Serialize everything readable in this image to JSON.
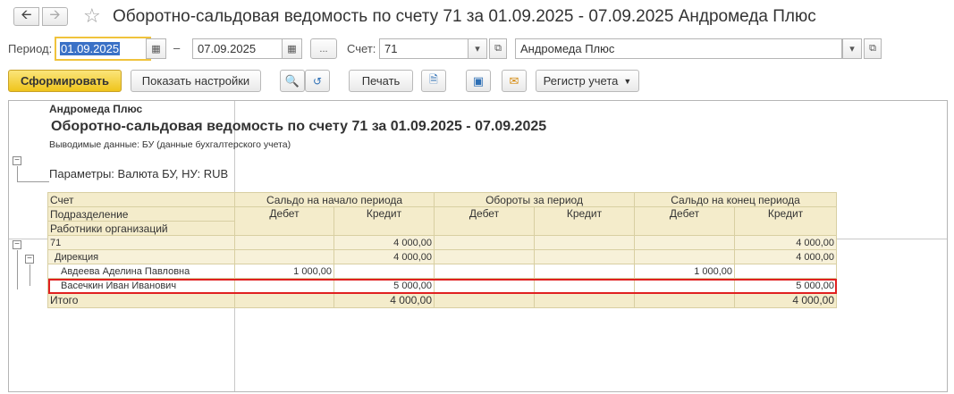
{
  "window": {
    "title": "Оборотно-сальдовая ведомость по счету 71 за 01.09.2025 - 07.09.2025 Андромеда Плюс",
    "back_icon": "arrow-left-icon",
    "forward_icon": "arrow-right-icon",
    "favorite_icon": "star-icon"
  },
  "params": {
    "period_label": "Период:",
    "date_from": "01.09.2025",
    "dash": "–",
    "date_to": "07.09.2025",
    "dots": "...",
    "account_label": "Счет:",
    "account": "71",
    "organization": "Андромеда Плюс"
  },
  "toolbar": {
    "generate": "Сформировать",
    "show_settings": "Показать настройки",
    "print": "Печать",
    "registry": "Регистр учета"
  },
  "report": {
    "org": "Андромеда Плюс",
    "title": "Оборотно-сальдовая ведомость по счету 71 за 01.09.2025 - 07.09.2025",
    "output": "Выводимые данные:  БУ (данные бухгалтерского учета)",
    "parameters": "Параметры:    Валюта БУ, НУ: RUB"
  },
  "table": {
    "headers": {
      "account": "Счет",
      "department": "Подразделение",
      "employees": "Работники организаций",
      "opening": "Сальдо на начало периода",
      "turnover": "Обороты за период",
      "closing": "Сальдо на конец периода",
      "debit": "Дебет",
      "credit": "Кредит"
    },
    "rows": [
      {
        "name": "71",
        "od": "",
        "oc": "4 000,00",
        "td": "",
        "tc": "",
        "cd": "",
        "cc": "4 000,00"
      },
      {
        "name": "Дирекция",
        "od": "",
        "oc": "4 000,00",
        "td": "",
        "tc": "",
        "cd": "",
        "cc": "4 000,00"
      },
      {
        "name": "Авдеева Аделина Павловна",
        "od": "1 000,00",
        "oc": "",
        "td": "",
        "tc": "",
        "cd": "1 000,00",
        "cc": ""
      },
      {
        "name": "Васечкин Иван Иванович",
        "od": "",
        "oc": "5 000,00",
        "td": "",
        "tc": "",
        "cd": "",
        "cc": "5 000,00"
      }
    ],
    "total": {
      "name": "Итого",
      "od": "",
      "oc": "4 000,00",
      "td": "",
      "tc": "",
      "cd": "",
      "cc": "4 000,00"
    }
  }
}
